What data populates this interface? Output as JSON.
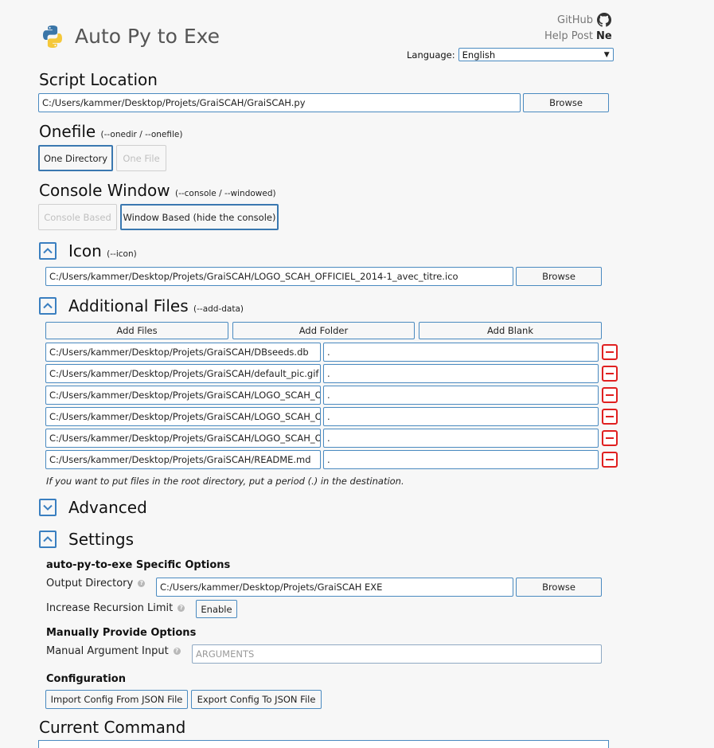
{
  "header": {
    "title": "Auto Py to Exe",
    "github_label": "GitHub",
    "help_post_label": "Help Post",
    "help_post_badge": "Ne",
    "language_label": "Language:",
    "language_value": "English"
  },
  "script_location": {
    "heading": "Script Location",
    "value": "C:/Users/kammer/Desktop/Projets/GraiSCAH/GraiSCAH.py",
    "browse_label": "Browse"
  },
  "onefile": {
    "heading": "Onefile",
    "flag": "(--onedir / --onefile)",
    "options": [
      "One Directory",
      "One File"
    ],
    "selected": "One Directory"
  },
  "console_window": {
    "heading": "Console Window",
    "flag": "(--console / --windowed)",
    "options": [
      "Console Based",
      "Window Based (hide the console)"
    ],
    "selected": "Window Based (hide the console)"
  },
  "icon": {
    "heading": "Icon",
    "flag": "(--icon)",
    "value": "C:/Users/kammer/Desktop/Projets/GraiSCAH/LOGO_SCAH_OFFICIEL_2014-1_avec_titre.ico",
    "browse_label": "Browse"
  },
  "additional_files": {
    "heading": "Additional Files",
    "flag": "(--add-data)",
    "add_files_label": "Add Files",
    "add_folder_label": "Add Folder",
    "add_blank_label": "Add Blank",
    "rows": [
      {
        "source": "C:/Users/kammer/Desktop/Projets/GraiSCAH/DBseeds.db",
        "dest": "."
      },
      {
        "source": "C:/Users/kammer/Desktop/Projets/GraiSCAH/default_pic.gif",
        "dest": "."
      },
      {
        "source": "C:/Users/kammer/Desktop/Projets/GraiSCAH/LOGO_SCAH_OF",
        "dest": "."
      },
      {
        "source": "C:/Users/kammer/Desktop/Projets/GraiSCAH/LOGO_SCAH_OF",
        "dest": "."
      },
      {
        "source": "C:/Users/kammer/Desktop/Projets/GraiSCAH/LOGO_SCAH_OF",
        "dest": "."
      },
      {
        "source": "C:/Users/kammer/Desktop/Projets/GraiSCAH/README.md",
        "dest": "."
      }
    ],
    "hint": "If you want to put files in the root directory, put a period (.) in the destination."
  },
  "advanced": {
    "heading": "Advanced"
  },
  "settings": {
    "heading": "Settings",
    "specific_heading": "auto-py-to-exe Specific Options",
    "output_dir_label": "Output Directory",
    "output_dir_value": "C:/Users/kammer/Desktop/Projets/GraiSCAH EXE",
    "browse_label": "Browse",
    "recursion_label": "Increase Recursion Limit",
    "enable_label": "Enable",
    "manual_heading": "Manually Provide Options",
    "manual_arg_label": "Manual Argument Input",
    "manual_arg_placeholder": "ARGUMENTS",
    "config_heading": "Configuration",
    "import_label": "Import Config From JSON File",
    "export_label": "Export Config To JSON File"
  },
  "current_command": {
    "heading": "Current Command"
  },
  "colors": {
    "accent": "#3a7fc0",
    "remove": "#e02020",
    "background": "#f7f7f7"
  }
}
